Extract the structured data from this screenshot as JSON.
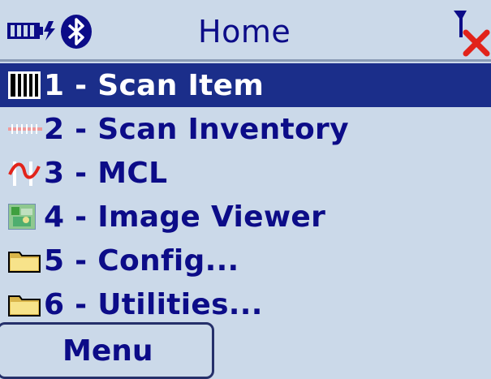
{
  "header": {
    "title": "Home",
    "icons": {
      "battery": "battery-charging-icon",
      "bluetooth": "bluetooth-icon",
      "signal": "antenna-no-signal-icon"
    }
  },
  "menu": {
    "items": [
      {
        "label": "1 - Scan Item",
        "icon": "barcode-icon",
        "selected": true
      },
      {
        "label": "2 - Scan Inventory",
        "icon": "scan-line-icon",
        "selected": false
      },
      {
        "label": "3 - MCL",
        "icon": "mcl-wave-icon",
        "selected": false
      },
      {
        "label": "4 - Image Viewer",
        "icon": "image-icon",
        "selected": false
      },
      {
        "label": "5 - Config...",
        "icon": "folder-icon",
        "selected": false
      },
      {
        "label": "6 - Utilities...",
        "icon": "folder-icon",
        "selected": false
      }
    ]
  },
  "softkey": {
    "label": "Menu"
  },
  "colors": {
    "background": "#cbd9e9",
    "text": "#0c0c88",
    "selection": "#1b2e8a",
    "alert": "#e2231a"
  }
}
